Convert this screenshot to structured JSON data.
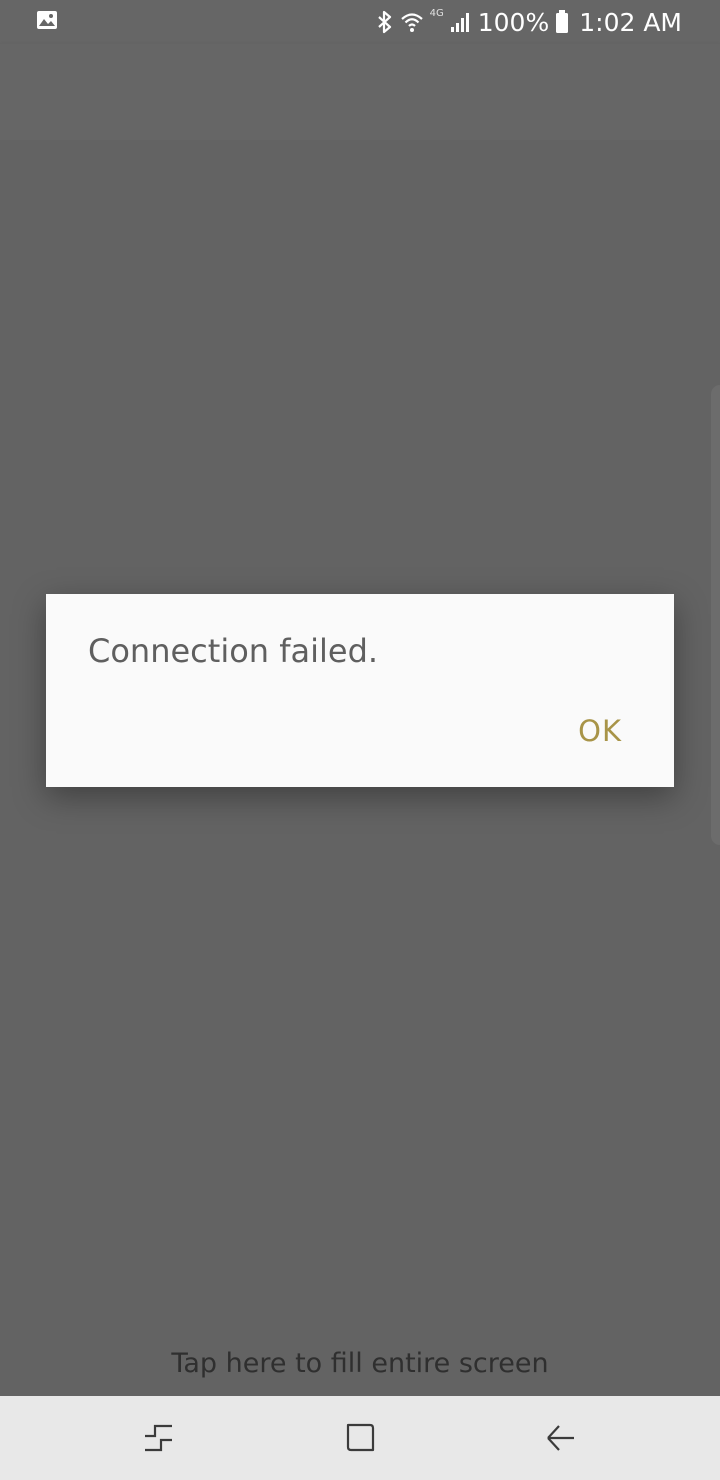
{
  "status_bar": {
    "notification_icon": "image-icon",
    "icons": [
      "bluetooth-icon",
      "wifi-icon",
      "signal-icon",
      "battery-icon"
    ],
    "network_type": "4G",
    "battery": "100%",
    "time": "1:02 AM"
  },
  "dialog": {
    "message": "Connection failed.",
    "ok_label": "OK"
  },
  "hint": {
    "fill_screen": "Tap here to fill entire screen"
  },
  "nav_bar": {
    "buttons": [
      "recents-icon",
      "home-icon",
      "back-icon"
    ]
  },
  "colors": {
    "background": "#636363",
    "dialog": "#fafafa",
    "accent": "#a89448",
    "nav_bar": "#e8e8e8"
  }
}
